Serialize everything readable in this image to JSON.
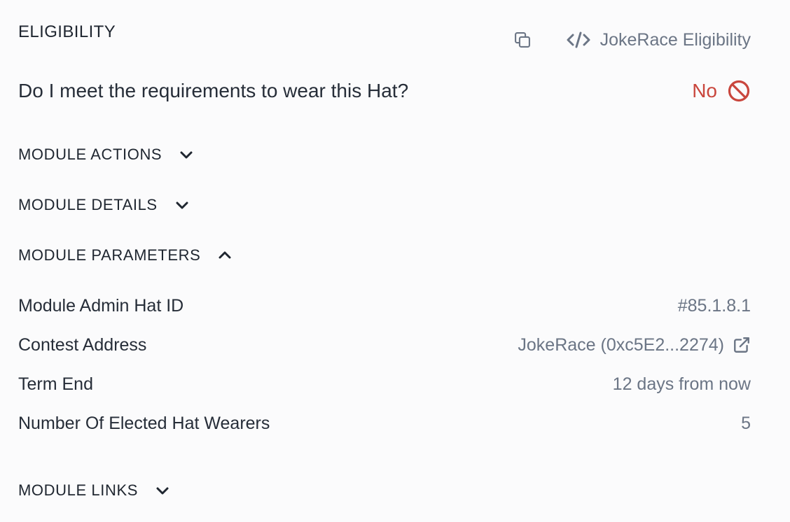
{
  "section": {
    "title": "ELIGIBILITY",
    "module_label": "JokeRace Eligibility",
    "icons": {
      "copy": "copy-icon",
      "module": "code-icon"
    }
  },
  "requirements": {
    "question": "Do I meet the requirements to wear this Hat?",
    "answer": "No",
    "answer_color": "#c9463d",
    "answer_icon": "prohibited-icon"
  },
  "sections": {
    "actions": {
      "label": "MODULE ACTIONS",
      "expanded": false
    },
    "details": {
      "label": "MODULE DETAILS",
      "expanded": false
    },
    "parameters": {
      "label": "MODULE PARAMETERS",
      "expanded": true
    },
    "links": {
      "label": "MODULE LINKS",
      "expanded": false
    }
  },
  "parameters": [
    {
      "key": "Module Admin Hat ID",
      "value": "#85.1.8.1"
    },
    {
      "key": "Contest Address",
      "value": "JokeRace (0xc5E2...2274)",
      "icon": "external-link-icon"
    },
    {
      "key": "Term End",
      "value": "12 days from now"
    },
    {
      "key": "Number Of Elected Hat Wearers",
      "value": "5"
    }
  ],
  "colors": {
    "text": "#262d38",
    "muted": "#6b7585",
    "danger": "#c9463d",
    "background": "#fbfbfc"
  }
}
